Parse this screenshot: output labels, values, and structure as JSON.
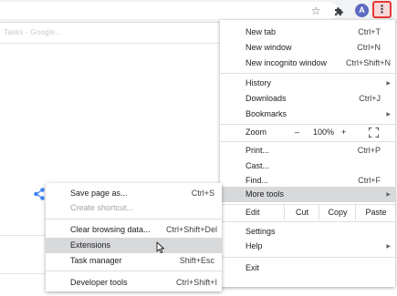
{
  "toolbar": {
    "icons": [
      "star-icon",
      "extensions-puzzle-icon",
      "kebab-menu-icon"
    ],
    "avatar_letter": "A",
    "avatar_color": "#5c6bc0",
    "highlight_color": "#e53935"
  },
  "page": {
    "tab_title": "Tasks - Google..."
  },
  "main_menu": {
    "new_tab": {
      "label": "New tab",
      "shortcut": "Ctrl+T"
    },
    "new_window": {
      "label": "New window",
      "shortcut": "Ctrl+N"
    },
    "new_incognito": {
      "label": "New incognito window",
      "shortcut": "Ctrl+Shift+N"
    },
    "history": {
      "label": "History"
    },
    "downloads": {
      "label": "Downloads",
      "shortcut": "Ctrl+J"
    },
    "bookmarks": {
      "label": "Bookmarks"
    },
    "zoom": {
      "label": "Zoom",
      "minus": "–",
      "value": "100%",
      "plus": "+"
    },
    "print": {
      "label": "Print...",
      "shortcut": "Ctrl+P"
    },
    "cast": {
      "label": "Cast..."
    },
    "find": {
      "label": "Find...",
      "shortcut": "Ctrl+F"
    },
    "more_tools": {
      "label": "More tools"
    },
    "edit": {
      "label": "Edit",
      "cut": "Cut",
      "copy": "Copy",
      "paste": "Paste"
    },
    "settings": {
      "label": "Settings"
    },
    "help": {
      "label": "Help"
    },
    "exit": {
      "label": "Exit"
    }
  },
  "sub_menu": {
    "save_page": {
      "label": "Save page as...",
      "shortcut": "Ctrl+S"
    },
    "create_shortcut": {
      "label": "Create shortcut..."
    },
    "clear_browsing": {
      "label": "Clear browsing data...",
      "shortcut": "Ctrl+Shift+Del"
    },
    "extensions": {
      "label": "Extensions"
    },
    "task_manager": {
      "label": "Task manager",
      "shortcut": "Shift+Esc"
    },
    "developer_tools": {
      "label": "Developer tools",
      "shortcut": "Ctrl+Shift+I"
    }
  }
}
